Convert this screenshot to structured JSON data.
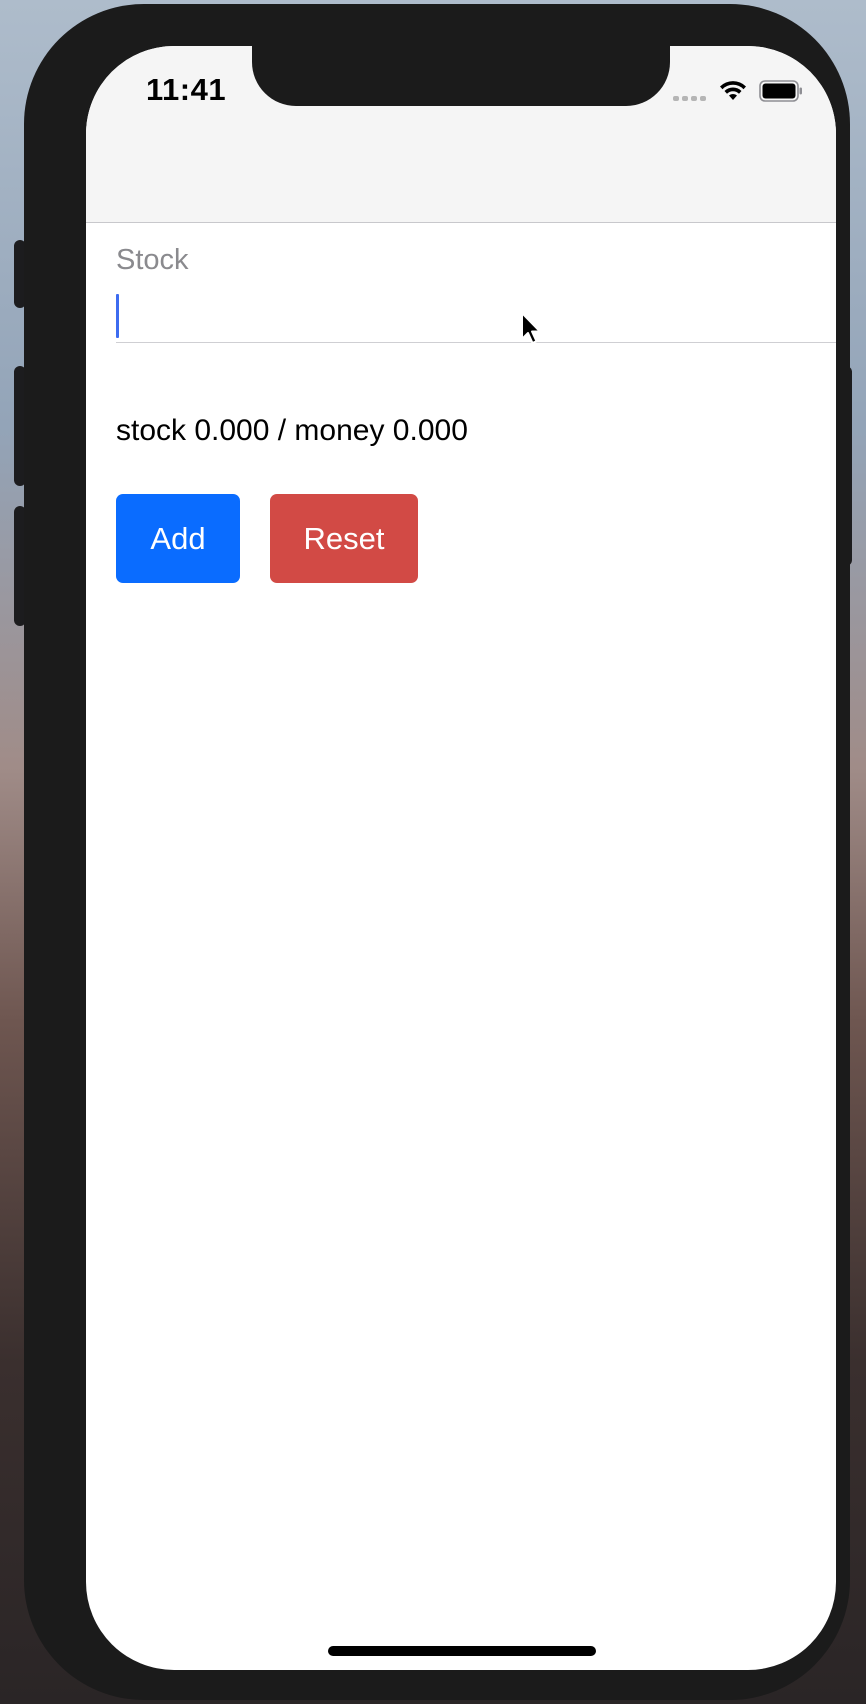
{
  "status_bar": {
    "time": "11:41"
  },
  "form": {
    "field_label": "Stock",
    "field_value": "",
    "summary": "stock 0.000 / money 0.000",
    "add_label": "Add",
    "reset_label": "Reset"
  },
  "colors": {
    "add_button": "#0a6cff",
    "reset_button": "#d24a45",
    "caret": "#3d6cf0",
    "nav_bar": "#f5f5f5"
  },
  "icons": [
    "signal-icon",
    "wifi-icon",
    "battery-icon",
    "mouse-pointer-icon"
  ]
}
